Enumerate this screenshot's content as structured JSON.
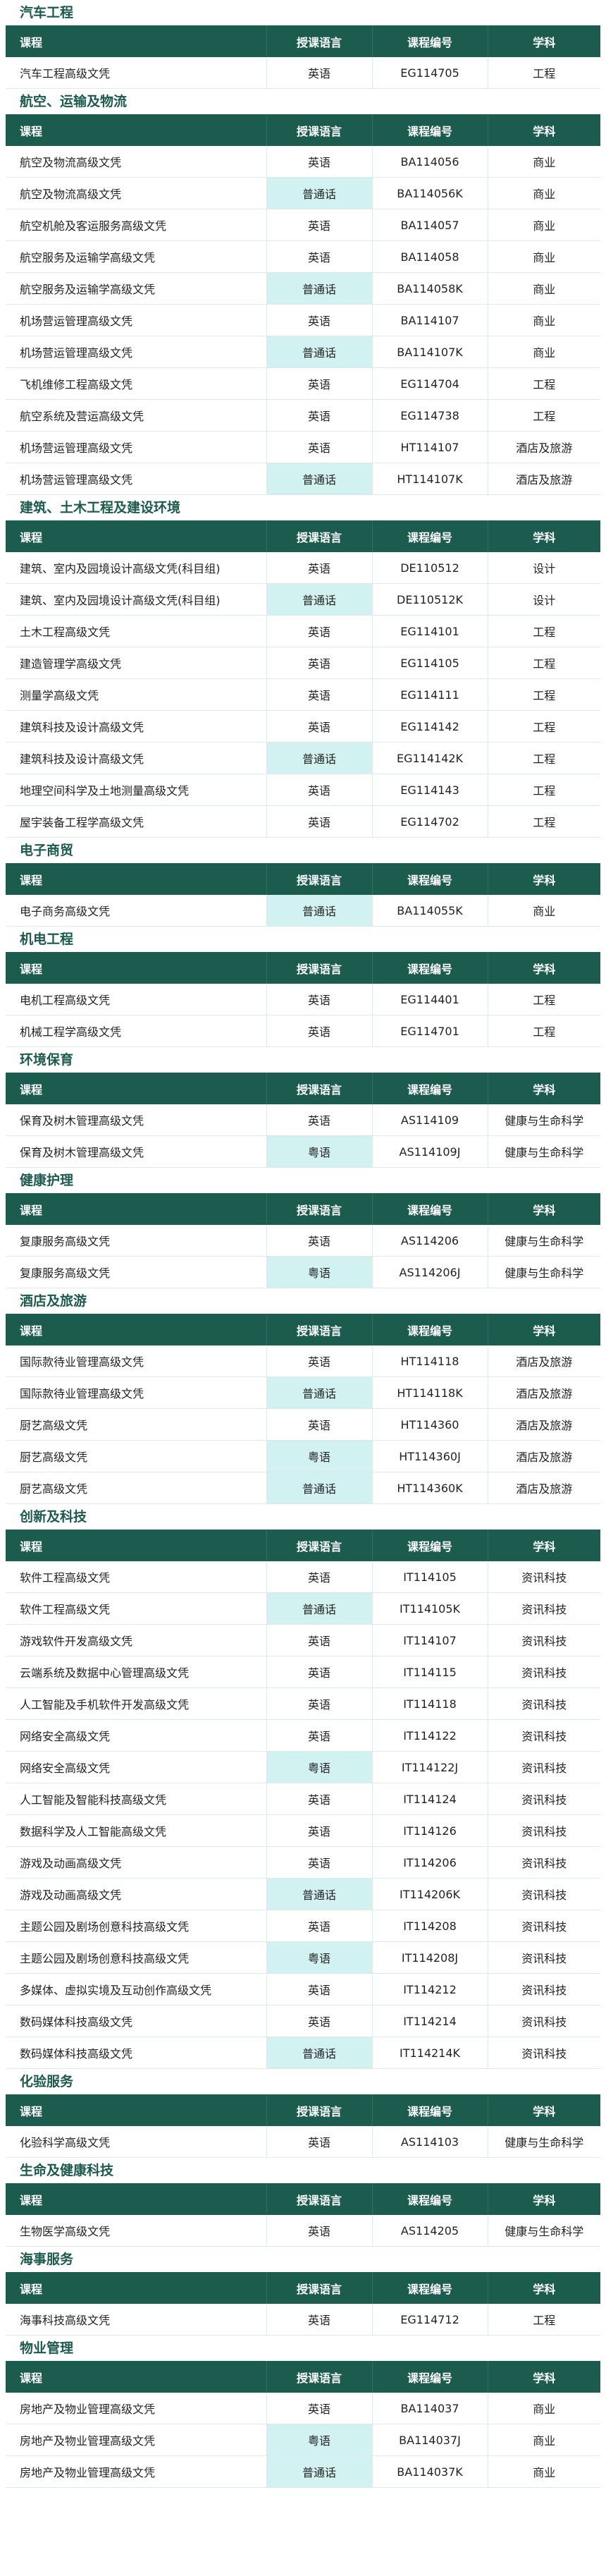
{
  "headers": [
    "课程",
    "授课语言",
    "课程编号",
    "学科"
  ],
  "sections": [
    {
      "title": "汽车工程",
      "rows": [
        [
          "汽车工程高级文凭",
          "英语",
          "EG114705",
          "工程"
        ]
      ]
    },
    {
      "title": "航空、运输及物流",
      "rows": [
        [
          "航空及物流高级文凭",
          "英语",
          "BA114056",
          "商业"
        ],
        [
          "航空及物流高级文凭",
          "普通话",
          "BA114056K",
          "商业"
        ],
        [
          "航空机舱及客运服务高级文凭",
          "英语",
          "BA114057",
          "商业"
        ],
        [
          "航空服务及运输学高级文凭",
          "英语",
          "BA114058",
          "商业"
        ],
        [
          "航空服务及运输学高级文凭",
          "普通话",
          "BA114058K",
          "商业"
        ],
        [
          "机场营运管理高级文凭",
          "英语",
          "BA114107",
          "商业"
        ],
        [
          "机场营运管理高级文凭",
          "普通话",
          "BA114107K",
          "商业"
        ],
        [
          "飞机维修工程高级文凭",
          "英语",
          "EG114704",
          "工程"
        ],
        [
          "航空系统及营运高级文凭",
          "英语",
          "EG114738",
          "工程"
        ],
        [
          "机场营运管理高级文凭",
          "英语",
          "HT114107",
          "酒店及旅游"
        ],
        [
          "机场营运管理高级文凭",
          "普通话",
          "HT114107K",
          "酒店及旅游"
        ]
      ]
    },
    {
      "title": "建筑、土木工程及建设环境",
      "rows": [
        [
          "建筑、室内及园境设计高级文凭(科目组)",
          "英语",
          "DE110512",
          "设计"
        ],
        [
          "建筑、室内及园境设计高级文凭(科目组)",
          "普通话",
          "DE110512K",
          "设计"
        ],
        [
          "土木工程高级文凭",
          "英语",
          "EG114101",
          "工程"
        ],
        [
          "建造管理学高级文凭",
          "英语",
          "EG114105",
          "工程"
        ],
        [
          "测量学高级文凭",
          "英语",
          "EG114111",
          "工程"
        ],
        [
          "建筑科技及设计高级文凭",
          "英语",
          "EG114142",
          "工程"
        ],
        [
          "建筑科技及设计高级文凭",
          "普通话",
          "EG114142K",
          "工程"
        ],
        [
          "地理空间科学及土地测量高级文凭",
          "英语",
          "EG114143",
          "工程"
        ],
        [
          "屋宇装备工程学高级文凭",
          "英语",
          "EG114702",
          "工程"
        ]
      ]
    },
    {
      "title": "电子商贸",
      "rows": [
        [
          "电子商务高级文凭",
          "普通话",
          "BA114055K",
          "商业"
        ]
      ]
    },
    {
      "title": "机电工程",
      "rows": [
        [
          "电机工程高级文凭",
          "英语",
          "EG114401",
          "工程"
        ],
        [
          "机械工程学高级文凭",
          "英语",
          "EG114701",
          "工程"
        ]
      ]
    },
    {
      "title": "环境保育",
      "rows": [
        [
          "保育及树木管理高级文凭",
          "英语",
          "AS114109",
          "健康与生命科学"
        ],
        [
          "保育及树木管理高级文凭",
          "粤语",
          "AS114109J",
          "健康与生命科学"
        ]
      ]
    },
    {
      "title": "健康护理",
      "rows": [
        [
          "复康服务高级文凭",
          "英语",
          "AS114206",
          "健康与生命科学"
        ],
        [
          "复康服务高级文凭",
          "粤语",
          "AS114206J",
          "健康与生命科学"
        ]
      ]
    },
    {
      "title": "酒店及旅游",
      "rows": [
        [
          "国际款待业管理高级文凭",
          "英语",
          "HT114118",
          "酒店及旅游"
        ],
        [
          "国际款待业管理高级文凭",
          "普通话",
          "HT114118K",
          "酒店及旅游"
        ],
        [
          "厨艺高级文凭",
          "英语",
          "HT114360",
          "酒店及旅游"
        ],
        [
          "厨艺高级文凭",
          "粤语",
          "HT114360J",
          "酒店及旅游"
        ],
        [
          "厨艺高级文凭",
          "普通话",
          "HT114360K",
          "酒店及旅游"
        ]
      ]
    },
    {
      "title": "创新及科技",
      "rows": [
        [
          "软件工程高级文凭",
          "英语",
          "IT114105",
          "资讯科技"
        ],
        [
          "软件工程高级文凭",
          "普通话",
          "IT114105K",
          "资讯科技"
        ],
        [
          "游戏软件开发高级文凭",
          "英语",
          "IT114107",
          "资讯科技"
        ],
        [
          "云端系统及数据中心管理高级文凭",
          "英语",
          "IT114115",
          "资讯科技"
        ],
        [
          "人工智能及手机软件开发高级文凭",
          "英语",
          "IT114118",
          "资讯科技"
        ],
        [
          "网络安全高级文凭",
          "英语",
          "IT114122",
          "资讯科技"
        ],
        [
          "网络安全高级文凭",
          "粤语",
          "IT114122J",
          "资讯科技"
        ],
        [
          "人工智能及智能科技高级文凭",
          "英语",
          "IT114124",
          "资讯科技"
        ],
        [
          "数据科学及人工智能高级文凭",
          "英语",
          "IT114126",
          "资讯科技"
        ],
        [
          "游戏及动画高级文凭",
          "英语",
          "IT114206",
          "资讯科技"
        ],
        [
          "游戏及动画高级文凭",
          "普通话",
          "IT114206K",
          "资讯科技"
        ],
        [
          "主题公园及剧场创意科技高级文凭",
          "英语",
          "IT114208",
          "资讯科技"
        ],
        [
          "主题公园及剧场创意科技高级文凭",
          "粤语",
          "IT114208J",
          "资讯科技"
        ],
        [
          "多媒体、虚拟实境及互动创作高级文凭",
          "英语",
          "IT114212",
          "资讯科技"
        ],
        [
          "数码媒体科技高级文凭",
          "英语",
          "IT114214",
          "资讯科技"
        ],
        [
          "数码媒体科技高级文凭",
          "普通话",
          "IT114214K",
          "资讯科技"
        ]
      ]
    },
    {
      "title": "化验服务",
      "rows": [
        [
          "化验科学高级文凭",
          "英语",
          "AS114103",
          "健康与生命科学"
        ]
      ]
    },
    {
      "title": "生命及健康科技",
      "rows": [
        [
          "生物医学高级文凭",
          "英语",
          "AS114205",
          "健康与生命科学"
        ]
      ]
    },
    {
      "title": "海事服务",
      "rows": [
        [
          "海事科技高级文凭",
          "英语",
          "EG114712",
          "工程"
        ]
      ]
    },
    {
      "title": "物业管理",
      "rows": [
        [
          "房地产及物业管理高级文凭",
          "英语",
          "BA114037",
          "商业"
        ],
        [
          "房地产及物业管理高级文凭",
          "粤语",
          "BA114037J",
          "商业"
        ],
        [
          "房地产及物业管理高级文凭",
          "普通话",
          "BA114037K",
          "商业"
        ]
      ]
    }
  ]
}
